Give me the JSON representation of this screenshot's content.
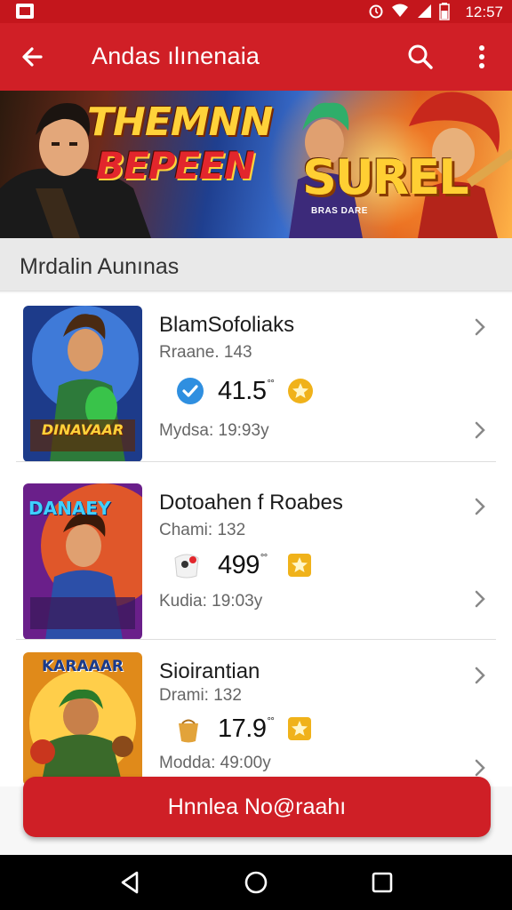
{
  "status_bar": {
    "time": "12:57",
    "icons": [
      "app-icon",
      "alarm-icon",
      "wifi-icon",
      "signal-icon",
      "battery-icon"
    ]
  },
  "app_bar": {
    "title": "Andas ılınenaia",
    "back_icon": "arrow-left-icon",
    "search_icon": "search-icon",
    "more_icon": "more-vertical-icon",
    "color": "#d01f26"
  },
  "banner": {
    "title_line1": "THEMNN",
    "title_line2": "BEPEEN",
    "title_right": "SUREL",
    "small_text": "BRAS DARE"
  },
  "section": {
    "title": "Mrdalin Aunınas"
  },
  "games": [
    {
      "title": "BlamSofoliaks",
      "subtitle": "Rraane. 143",
      "rating": "41.5",
      "rating_sup": "°°",
      "meta": "Mydsa: 19:93y",
      "badge_icon": "verified-check-icon",
      "thumb_text": "DINAVAAR"
    },
    {
      "title": "Dotoahen f Roabes",
      "subtitle": "Chami: 132",
      "rating": "499",
      "rating_sup": "°°",
      "meta": "Kudia: 19:03y",
      "badge_icon": "sticker-icon",
      "thumb_text": "DANAEY"
    },
    {
      "title": "Sioirantian",
      "subtitle": "Drami: 132",
      "rating": "17.9",
      "rating_sup": "°°",
      "meta": "Modda: 49:00y",
      "badge_icon": "pouch-icon",
      "thumb_text": "KARAAAR"
    }
  ],
  "cta": {
    "label": "Hnnlea No@raahı"
  },
  "nav": {
    "icons": [
      "back-triangle-icon",
      "home-circle-icon",
      "recents-square-icon"
    ]
  },
  "colors": {
    "primary": "#d01f26",
    "star": "#f0b21a",
    "verified": "#2f8fe0"
  }
}
